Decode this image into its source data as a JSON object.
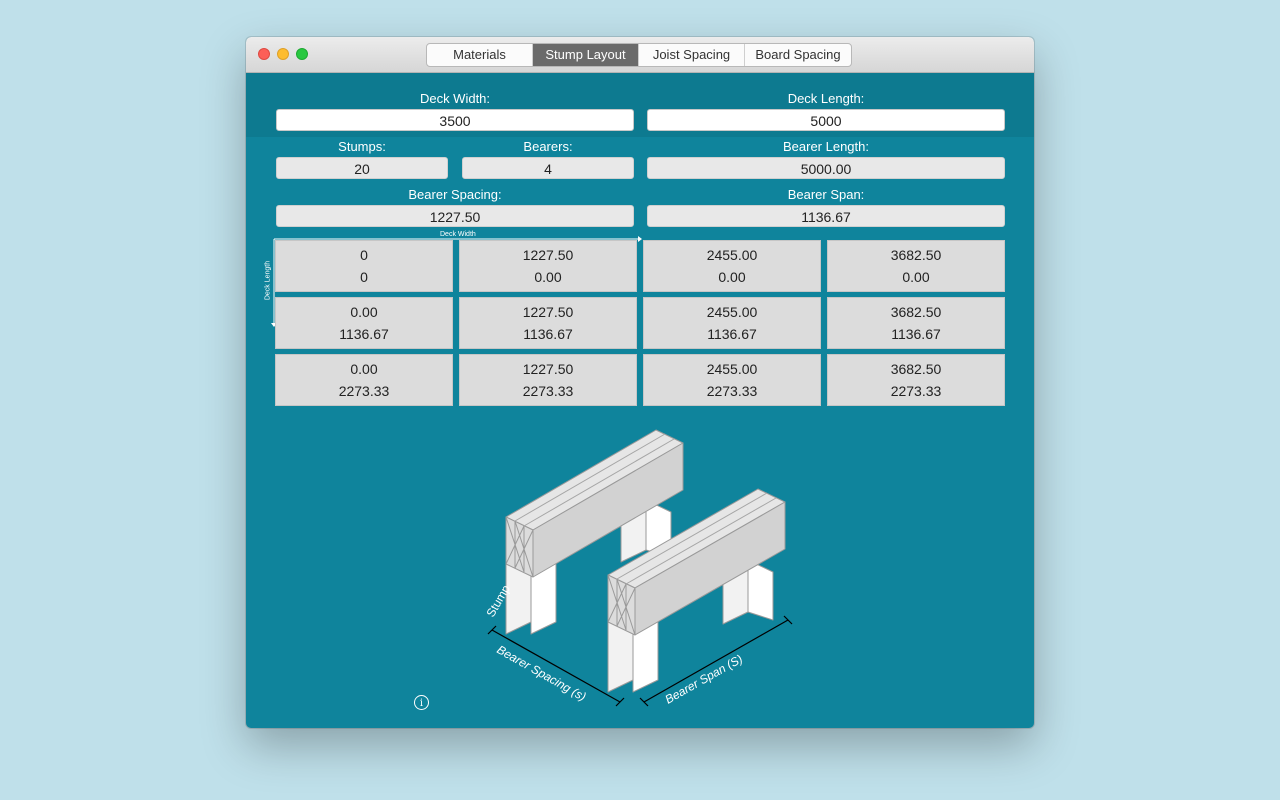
{
  "tabs": [
    {
      "label": "Materials"
    },
    {
      "label": "Stump Layout",
      "active": true
    },
    {
      "label": "Joist Spacing"
    },
    {
      "label": "Board Spacing"
    }
  ],
  "deck_width": {
    "label": "Deck Width:",
    "value": "3500"
  },
  "deck_length": {
    "label": "Deck Length:",
    "value": "5000"
  },
  "stumps": {
    "label": "Stumps:",
    "value": "20"
  },
  "bearers": {
    "label": "Bearers:",
    "value": "4"
  },
  "bearer_length": {
    "label": "Bearer Length:",
    "value": "5000.00"
  },
  "bearer_spacing": {
    "label": "Bearer Spacing:",
    "value": "1227.50"
  },
  "bearer_span": {
    "label": "Bearer Span:",
    "value": "1136.67"
  },
  "grid_axis": {
    "width_label": "Deck Width",
    "length_label": "Deck Length"
  },
  "grid": [
    [
      {
        "x": "0",
        "y": "0"
      },
      {
        "x": "1227.50",
        "y": "0.00"
      },
      {
        "x": "2455.00",
        "y": "0.00"
      },
      {
        "x": "3682.50",
        "y": "0.00"
      }
    ],
    [
      {
        "x": "0.00",
        "y": "1136.67"
      },
      {
        "x": "1227.50",
        "y": "1136.67"
      },
      {
        "x": "2455.00",
        "y": "1136.67"
      },
      {
        "x": "3682.50",
        "y": "1136.67"
      }
    ],
    [
      {
        "x": "0.00",
        "y": "2273.33"
      },
      {
        "x": "1227.50",
        "y": "2273.33"
      },
      {
        "x": "2455.00",
        "y": "2273.33"
      },
      {
        "x": "3682.50",
        "y": "2273.33"
      }
    ]
  ],
  "diagram": {
    "stump_label": "Stump",
    "bearer_spacing_label": "Bearer Spacing (s)",
    "bearer_span_label": "Bearer Span (S)"
  },
  "info_glyph": "i"
}
